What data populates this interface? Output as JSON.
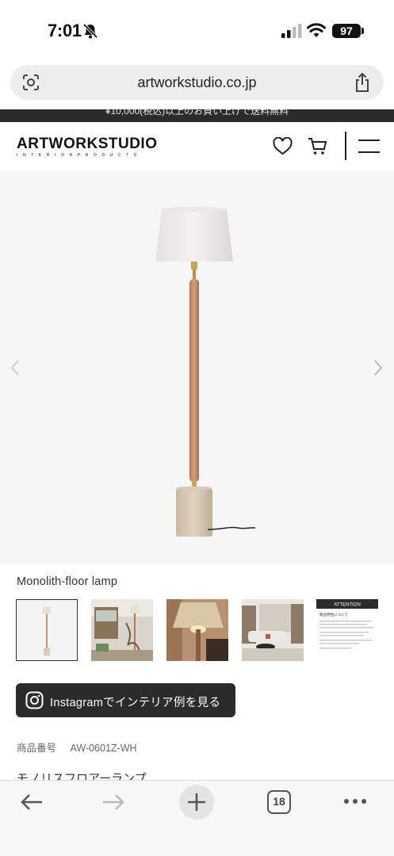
{
  "status_bar": {
    "time": "7:01",
    "battery": "97",
    "icons": [
      "bell-muted-icon",
      "signal-icon",
      "wifi-icon",
      "battery-icon"
    ]
  },
  "browser": {
    "url": "artworkstudio.co.jp",
    "icons": [
      "lens-icon",
      "share-icon"
    ]
  },
  "announcement": {
    "text": "¥10,000(税込)以上のお買い上げで送料無料"
  },
  "header": {
    "logo_main": "ARTWORKSTUDIO",
    "logo_sub": "INTERIORPRODUCTS",
    "icons": [
      "heart-icon",
      "cart-icon",
      "menu-icon"
    ]
  },
  "product": {
    "title": "Monolith-floor lamp",
    "code_label": "商品番号",
    "code_value": "AW-0601Z-WH",
    "name_jp": "モノリスフロアーランプ",
    "thumb_attention_title": "ATTENTION",
    "thumb_attention_heading": "製品特性について"
  },
  "instagram_button": {
    "label": "Instagramでインテリア例を見る"
  },
  "toolbar": {
    "tab_count": "18",
    "icons": [
      "back-arrow-icon",
      "forward-arrow-icon",
      "plus-icon",
      "tabs-icon",
      "more-icon"
    ]
  },
  "colors": {
    "dark_bar": "#2b2b2b",
    "url_bar_bg": "#ecedef",
    "hero_bg": "#f6f6f6",
    "lamp_wood": "#c8926a",
    "lamp_brass": "#c8a455"
  }
}
